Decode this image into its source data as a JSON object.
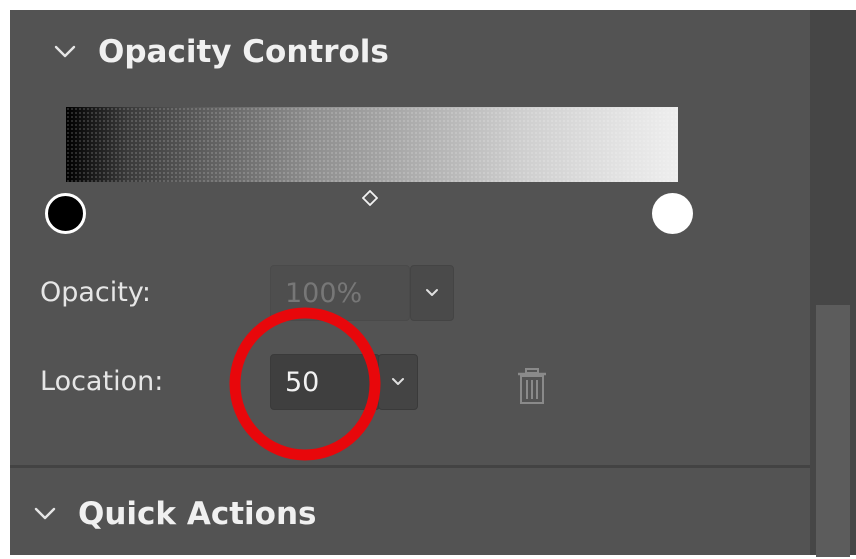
{
  "opacity_section": {
    "title": "Opacity Controls",
    "opacity": {
      "label": "Opacity:",
      "value": "100%"
    },
    "location": {
      "label": "Location:",
      "value": "50"
    },
    "gradient": {
      "left_stop_color": "#000000",
      "right_stop_color": "#ffffff",
      "midpoint_location_percent": 50
    }
  },
  "quick_actions_section": {
    "title": "Quick Actions"
  },
  "colors": {
    "panel_bg": "#535353",
    "text": "#f0f0f0",
    "annotation": "#e8070b"
  }
}
